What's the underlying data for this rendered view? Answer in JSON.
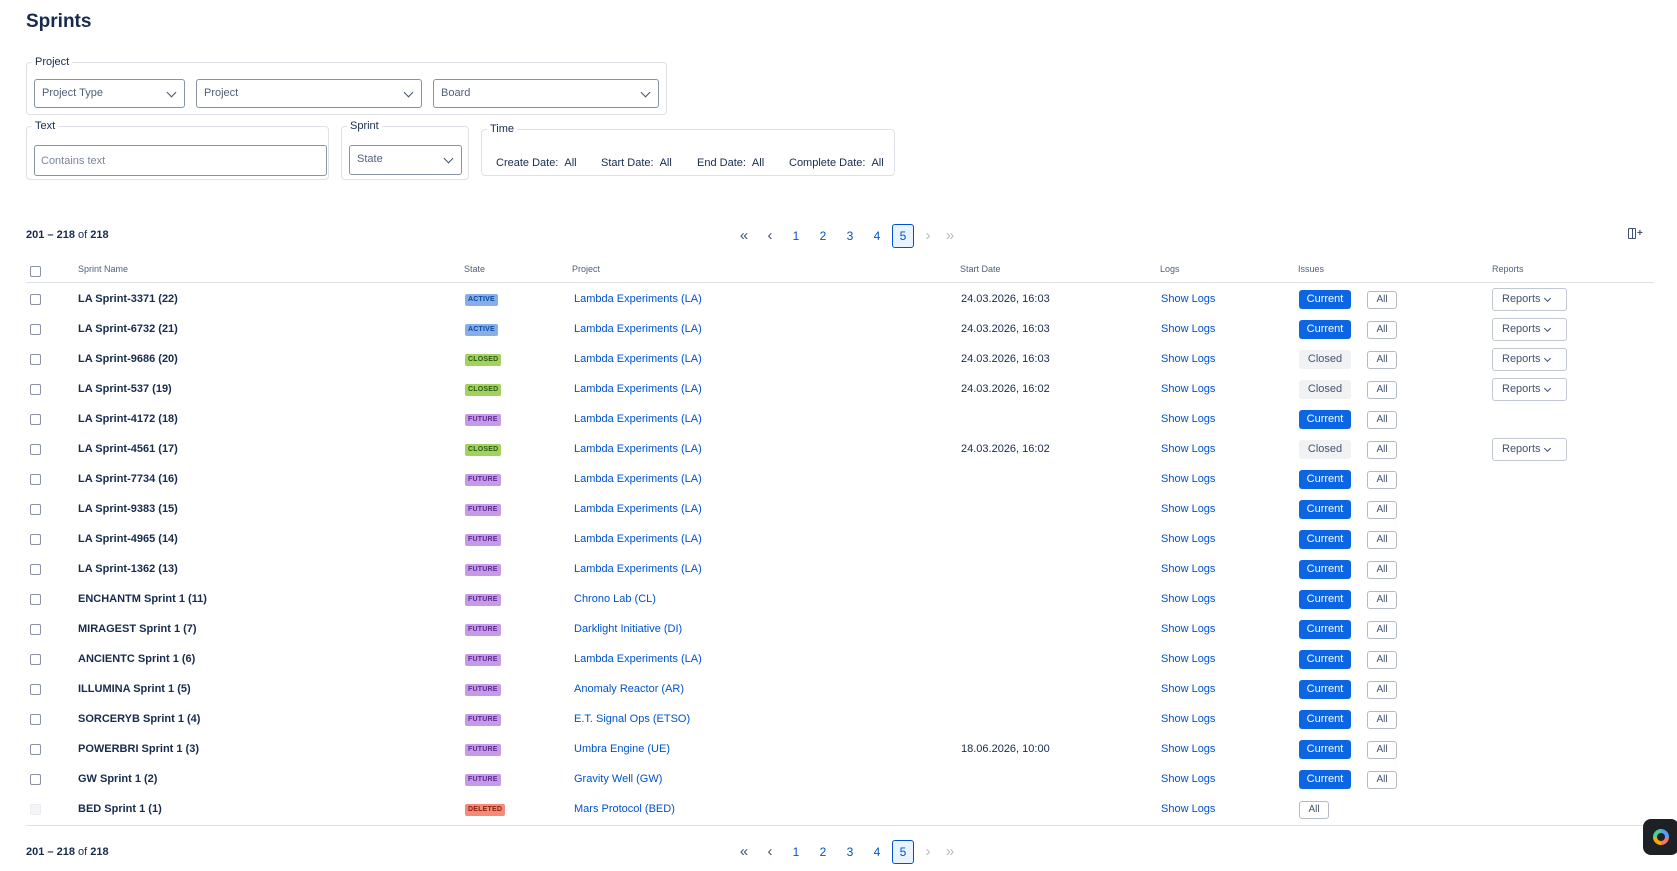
{
  "page": {
    "title": "Sprints"
  },
  "filters": {
    "project_group": {
      "legend": "Project",
      "project_type": "Project Type",
      "project": "Project",
      "board": "Board"
    },
    "text_group": {
      "legend": "Text",
      "placeholder": "Contains text"
    },
    "sprint_group": {
      "legend": "Sprint",
      "state": "State"
    },
    "time_group": {
      "legend": "Time",
      "items": [
        {
          "label": "Create Date:",
          "value": "All"
        },
        {
          "label": "Start Date:",
          "value": "All"
        },
        {
          "label": "End Date:",
          "value": "All"
        },
        {
          "label": "Complete Date:",
          "value": "All"
        }
      ]
    }
  },
  "pagination": {
    "range": "201 – 218",
    "of_label": "of",
    "total": "218",
    "pages": [
      "1",
      "2",
      "3",
      "4",
      "5"
    ],
    "current_page": "5"
  },
  "table": {
    "columns": {
      "sprint_name": "Sprint Name",
      "state": "State",
      "project": "Project",
      "start_date": "Start Date",
      "logs": "Logs",
      "issues": "Issues",
      "reports": "Reports"
    },
    "rows": [
      {
        "name": "LA Sprint-3371 (22)",
        "state": "ACTIVE",
        "project": "Lambda Experiments (LA)",
        "start_date": "24.03.2026, 16:03",
        "logs": "Show Logs",
        "issues_primary": "Current",
        "issues_all": "All",
        "reports": "Reports"
      },
      {
        "name": "LA Sprint-6732 (21)",
        "state": "ACTIVE",
        "project": "Lambda Experiments (LA)",
        "start_date": "24.03.2026, 16:03",
        "logs": "Show Logs",
        "issues_primary": "Current",
        "issues_all": "All",
        "reports": "Reports"
      },
      {
        "name": "LA Sprint-9686 (20)",
        "state": "CLOSED",
        "project": "Lambda Experiments (LA)",
        "start_date": "24.03.2026, 16:03",
        "logs": "Show Logs",
        "issues_primary": "Closed",
        "issues_all": "All",
        "reports": "Reports"
      },
      {
        "name": "LA Sprint-537 (19)",
        "state": "CLOSED",
        "project": "Lambda Experiments (LA)",
        "start_date": "24.03.2026, 16:02",
        "logs": "Show Logs",
        "issues_primary": "Closed",
        "issues_all": "All",
        "reports": "Reports"
      },
      {
        "name": "LA Sprint-4172 (18)",
        "state": "FUTURE",
        "project": "Lambda Experiments (LA)",
        "start_date": "",
        "logs": "Show Logs",
        "issues_primary": "Current",
        "issues_all": "All",
        "reports": ""
      },
      {
        "name": "LA Sprint-4561 (17)",
        "state": "CLOSED",
        "project": "Lambda Experiments (LA)",
        "start_date": "24.03.2026, 16:02",
        "logs": "Show Logs",
        "issues_primary": "Closed",
        "issues_all": "All",
        "reports": "Reports"
      },
      {
        "name": "LA Sprint-7734 (16)",
        "state": "FUTURE",
        "project": "Lambda Experiments (LA)",
        "start_date": "",
        "logs": "Show Logs",
        "issues_primary": "Current",
        "issues_all": "All",
        "reports": ""
      },
      {
        "name": "LA Sprint-9383 (15)",
        "state": "FUTURE",
        "project": "Lambda Experiments (LA)",
        "start_date": "",
        "logs": "Show Logs",
        "issues_primary": "Current",
        "issues_all": "All",
        "reports": ""
      },
      {
        "name": "LA Sprint-4965 (14)",
        "state": "FUTURE",
        "project": "Lambda Experiments (LA)",
        "start_date": "",
        "logs": "Show Logs",
        "issues_primary": "Current",
        "issues_all": "All",
        "reports": ""
      },
      {
        "name": "LA Sprint-1362 (13)",
        "state": "FUTURE",
        "project": "Lambda Experiments (LA)",
        "start_date": "",
        "logs": "Show Logs",
        "issues_primary": "Current",
        "issues_all": "All",
        "reports": ""
      },
      {
        "name": "ENCHANTM Sprint 1 (11)",
        "state": "FUTURE",
        "project": "Chrono Lab (CL)",
        "start_date": "",
        "logs": "Show Logs",
        "issues_primary": "Current",
        "issues_all": "All",
        "reports": ""
      },
      {
        "name": "MIRAGEST Sprint 1 (7)",
        "state": "FUTURE",
        "project": "Darklight Initiative (DI)",
        "start_date": "",
        "logs": "Show Logs",
        "issues_primary": "Current",
        "issues_all": "All",
        "reports": ""
      },
      {
        "name": "ANCIENTC Sprint 1 (6)",
        "state": "FUTURE",
        "project": "Lambda Experiments (LA)",
        "start_date": "",
        "logs": "Show Logs",
        "issues_primary": "Current",
        "issues_all": "All",
        "reports": ""
      },
      {
        "name": "ILLUMINA Sprint 1 (5)",
        "state": "FUTURE",
        "project": "Anomaly Reactor (AR)",
        "start_date": "",
        "logs": "Show Logs",
        "issues_primary": "Current",
        "issues_all": "All",
        "reports": ""
      },
      {
        "name": "SORCERYB Sprint 1 (4)",
        "state": "FUTURE",
        "project": "E.T. Signal Ops (ETSO)",
        "start_date": "",
        "logs": "Show Logs",
        "issues_primary": "Current",
        "issues_all": "All",
        "reports": ""
      },
      {
        "name": "POWERBRI Sprint 1 (3)",
        "state": "FUTURE",
        "project": "Umbra Engine (UE)",
        "start_date": "18.06.2026, 10:00",
        "logs": "Show Logs",
        "issues_primary": "Current",
        "issues_all": "All",
        "reports": ""
      },
      {
        "name": "GW Sprint 1 (2)",
        "state": "FUTURE",
        "project": "Gravity Well (GW)",
        "start_date": "",
        "logs": "Show Logs",
        "issues_primary": "Current",
        "issues_all": "All",
        "reports": ""
      },
      {
        "name": "BED Sprint 1 (1)",
        "state": "DELETED",
        "project": "Mars Protocol (BED)",
        "start_date": "",
        "logs": "Show Logs",
        "issues_primary": "",
        "issues_all": "All",
        "reports": ""
      }
    ]
  },
  "icons": {
    "first_page": "double-chevron-left-icon",
    "prev_page": "chevron-left-icon",
    "next_page": "chevron-right-icon",
    "last_page": "double-chevron-right-icon",
    "column_settings": "column-add-icon",
    "dropdown": "chevron-down-icon",
    "assistant": "rovo-assistant-icon"
  },
  "colors": {
    "link": "#0052cc",
    "primary_button": "#0c66e4",
    "active": "#89aee6",
    "closed": "#a3d15f",
    "future": "#c59ae6",
    "deleted": "#f48b79"
  }
}
